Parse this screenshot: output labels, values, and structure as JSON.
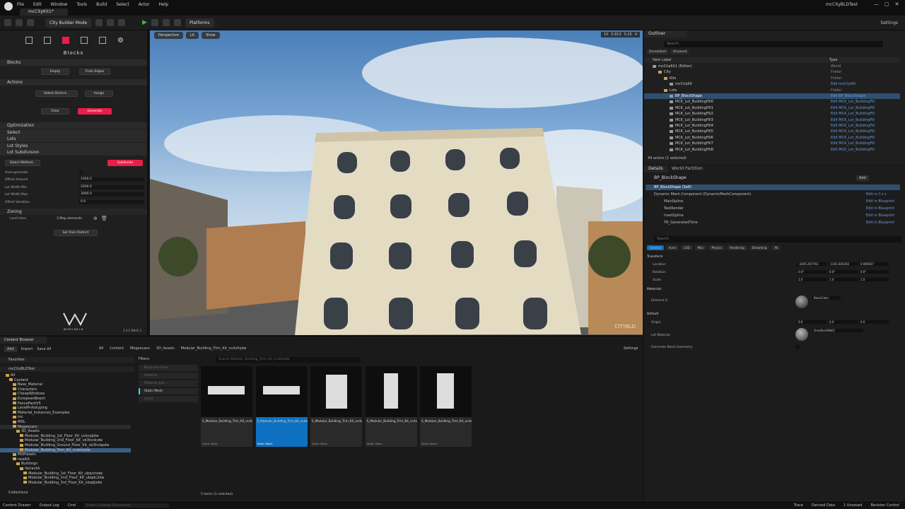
{
  "window": {
    "title": "mcCityBLDTest",
    "tab": "mcCityKit1*"
  },
  "menu": [
    "File",
    "Edit",
    "Window",
    "Tools",
    "Build",
    "Select",
    "Actor",
    "Help"
  ],
  "toolbar": {
    "mode": "City Builder Mode",
    "platforms": "Platforms",
    "settings": "Settings"
  },
  "viewport": {
    "perspective": "Perspective",
    "lit": "Lit",
    "show": "Show",
    "grid": "10",
    "angle": "5.813",
    "scale": "0.25",
    "cam": "4",
    "watermark": "CITYBLD"
  },
  "blocks": {
    "title": "Blocks",
    "sections": {
      "blocks": "Blocks",
      "actions": "Actions",
      "optimization": "Optimization",
      "select": "Select",
      "lots": "Lots",
      "lot_styles": "Lot Styles",
      "lot_subdivision": "Lot Subdivision",
      "zoning": "Zoning"
    },
    "buttons": {
      "empty": "Empty",
      "from_edges": "From Edges",
      "select_district": "Select District...",
      "assign": "Assign",
      "clear": "Clear",
      "generate": "Generate",
      "select_method": "Select Method...",
      "subdivide": "Subdivide",
      "set_from_district": "Set from District"
    },
    "fields": [
      {
        "label": "Auto-generate",
        "value": ""
      },
      {
        "label": "Offset Amount",
        "value": "1000.0"
      },
      {
        "label": "Lot Width Min",
        "value": "2000.0"
      },
      {
        "label": "Lot Width Max",
        "value": "3000.0"
      },
      {
        "label": "Offset Variation",
        "value": "0.0"
      }
    ],
    "land_uses": {
      "label": "Land Uses",
      "value": "3 Map elements"
    },
    "logo_text": "WORLDBLD",
    "version": "2.3.1 Patch 1"
  },
  "outliner": {
    "tab": "Outliner",
    "search": "Search",
    "filters": [
      "Unrealized",
      "Unsaved"
    ],
    "col_label": "Item Label",
    "col_type": "Type",
    "rows": [
      {
        "label": "mcCityKit1 (Editor)",
        "type": "World",
        "indent": 1,
        "link": false
      },
      {
        "label": "City",
        "type": "Folder",
        "indent": 2,
        "link": false
      },
      {
        "label": "Kits",
        "type": "Folder",
        "indent": 3,
        "link": false
      },
      {
        "label": "mcCityKit",
        "type": "Edit mcCityKit",
        "indent": 4,
        "link": true
      },
      {
        "label": "Lots",
        "type": "Folder",
        "indent": 3,
        "link": false
      },
      {
        "label": "BP_BlockShape",
        "type": "Edit BP_BlockShape",
        "indent": 4,
        "link": true,
        "sel": true
      },
      {
        "label": "MCK_Lot_BuildingFill0",
        "type": "Edit MCK_Lot_BuildingFill",
        "indent": 4,
        "link": true
      },
      {
        "label": "MCK_Lot_BuildingFill1",
        "type": "Edit MCK_Lot_BuildingFill",
        "indent": 4,
        "link": true
      },
      {
        "label": "MCK_Lot_BuildingFill2",
        "type": "Edit MCK_Lot_BuildingFill",
        "indent": 4,
        "link": true
      },
      {
        "label": "MCK_Lot_BuildingFill3",
        "type": "Edit MCK_Lot_BuildingFill",
        "indent": 4,
        "link": true
      },
      {
        "label": "MCK_Lot_BuildingFill4",
        "type": "Edit MCK_Lot_BuildingFill",
        "indent": 4,
        "link": true
      },
      {
        "label": "MCK_Lot_BuildingFill5",
        "type": "Edit MCK_Lot_BuildingFill",
        "indent": 4,
        "link": true
      },
      {
        "label": "MCK_Lot_BuildingFill6",
        "type": "Edit MCK_Lot_BuildingFill",
        "indent": 4,
        "link": true
      },
      {
        "label": "MCK_Lot_BuildingFill7",
        "type": "Edit MCK_Lot_BuildingFill",
        "indent": 4,
        "link": true
      },
      {
        "label": "MCK_Lot_BuildingFill8",
        "type": "Edit MCK_Lot_BuildingFill",
        "indent": 4,
        "link": true
      }
    ],
    "count": "44 actors (1 selected)"
  },
  "details": {
    "tab": "Details",
    "tab2": "World Partition",
    "actor": "BP_BlockShape",
    "add": "Add",
    "self": "BP_BlockShape (Self)",
    "components": [
      {
        "label": "Dynamic Mesh Component (DynamicMeshComponent)",
        "link": "Edit in C++"
      },
      {
        "label": "MainSpline",
        "link": "Edit in Blueprint"
      },
      {
        "label": "TextRender",
        "link": "Edit in Blueprint"
      },
      {
        "label": "InsetSpline",
        "link": "Edit in Blueprint"
      },
      {
        "label": "TR_GeneratedTime",
        "link": "Edit in Blueprint"
      }
    ],
    "search": "Search",
    "categories": [
      "General",
      "Actor",
      "LOD",
      "Misc",
      "Physics",
      "Rendering",
      "Streaming",
      "All"
    ],
    "transform": {
      "header": "Transform",
      "location": "Location",
      "rotation": "Rotation",
      "scale": "Scale",
      "loc": [
        "-3305.207793",
        "-1341.605202",
        "0.000027"
      ],
      "rot": [
        "0.0°",
        "0.0°",
        "0.0°"
      ],
      "scl": [
        "1.0",
        "1.0",
        "1.0"
      ]
    },
    "materials": {
      "header": "Materials",
      "element": "Element 0",
      "value": "BlockColor"
    },
    "default": {
      "header": "Default",
      "origin": "Origin",
      "origin_vals": [
        "0.0",
        "0.0",
        "0.0"
      ],
      "lot_material": "Lot Material",
      "lot_value": "GreyRockWall2",
      "generate": "Generate Block Geometry"
    }
  },
  "content_browser": {
    "tab": "Content Browser",
    "add": "Add",
    "import": "Import",
    "save_all": "Save All",
    "path": [
      "All",
      "Content",
      "Megascans",
      "3D_Assets",
      "Modular_Building_Trim_Kit_vcdxfcjdw"
    ],
    "settings": "Settings",
    "favorites": "Favorites",
    "project": "mcCityBLDTest",
    "filters_title": "Filters",
    "filters": [
      "Blueprint Class",
      "Material",
      "Material Inst...",
      "Static Mesh",
      "Level"
    ],
    "search": "Search Modular_Building_Trim_Kit_vcdxfcjdw",
    "collections": "Collections",
    "count": "5 items (1 selected)",
    "tree": [
      {
        "label": "All",
        "i": 0
      },
      {
        "label": "Content",
        "i": 1
      },
      {
        "label": "Base_Material",
        "i": 2
      },
      {
        "label": "Characters",
        "i": 2
      },
      {
        "label": "CheapWindows",
        "i": 2
      },
      {
        "label": "EuropeanBeech",
        "i": 2
      },
      {
        "label": "FencePackV5",
        "i": 2
      },
      {
        "label": "LevelPrototyping",
        "i": 2
      },
      {
        "label": "Material_Instances_Examples",
        "i": 2
      },
      {
        "label": "mc",
        "i": 2
      },
      {
        "label": "MDL",
        "i": 2
      },
      {
        "label": "Megascans",
        "i": 2,
        "hl": true
      },
      {
        "label": "3D_Assets",
        "i": 3
      },
      {
        "label": "Modular_Building_1st_Floor_Kit_vcknajidw",
        "i": 4
      },
      {
        "label": "Modular_Building_2nd_Floor_Kit_vb3hcdcdw",
        "i": 4
      },
      {
        "label": "Modular_Building_Ground_Floor_Kit_vb3hcbpdw",
        "i": 4
      },
      {
        "label": "Modular_Building_Trim_Kit_vcdxfcjdw",
        "i": 4,
        "sel": true
      },
      {
        "label": "MSPresets",
        "i": 2
      },
      {
        "label": "newKit",
        "i": 2
      },
      {
        "label": "Buildings",
        "i": 3
      },
      {
        "label": "VariantA",
        "i": 4
      },
      {
        "label": "Modular_Building_1st_Floor_Kit_ubqchsdw",
        "i": 5
      },
      {
        "label": "Modular_Building_2nd_Floor_Kit_ubqdc2dw",
        "i": 5
      },
      {
        "label": "Modular_Building_3rd_Floor_Kit_ubqdjsdw",
        "i": 5
      }
    ],
    "assets": [
      {
        "name": "S_Modular_Building_Trim_Kit_vcdxfcjdw_lod3_Var1",
        "type": "Static Mesh"
      },
      {
        "name": "S_Modular_Building_Trim_Kit_vcdxfcjdw_lod3_Var3",
        "type": "Static Mesh",
        "sel": true
      },
      {
        "name": "S_Modular_Building_Trim_Kit_vcdxfcjdw_lod3_Var3",
        "type": "Static Mesh"
      },
      {
        "name": "S_Modular_Building_Trim_Kit_vcdxfcjdw_lod3_Var4",
        "type": "Static Mesh"
      },
      {
        "name": "S_Modular_Building_Trim_Kit_vcdxfcjdw_lod3_Var5",
        "type": "Static Mesh"
      }
    ]
  },
  "statusbar": {
    "drawer": "Content Drawer",
    "output": "Output Log",
    "cmd": "Cmd",
    "console": "Enter Console Command",
    "trace": "Trace",
    "derived": "Derived Data",
    "unsaved": "1 Unsaved",
    "revision": "Revision Control"
  }
}
